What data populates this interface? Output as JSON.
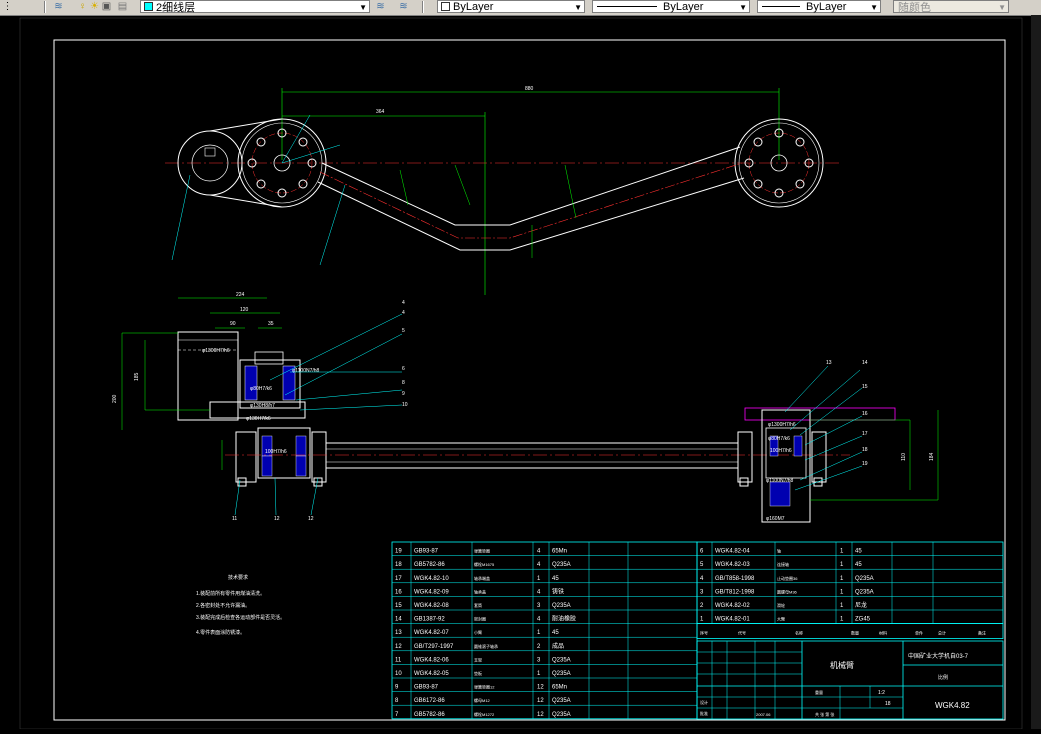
{
  "toolbar": {
    "layer_name": "2细线层",
    "color_value": "ByLayer",
    "linetype_value": "ByLayer",
    "lineweight_value": "ByLayer",
    "plotstyle_value": "随颜色"
  },
  "drawing": {
    "dims": {
      "d880": "880",
      "d364": "364",
      "d224": "224",
      "d120": "120",
      "d90": "90",
      "d35": "35",
      "d185": "185",
      "d200": "200",
      "d110": "110",
      "d184": "184"
    },
    "fits": {
      "f1": "φ1300H7/h6",
      "f2": "φ1100N7/h8",
      "f3": "φ130H8/h7",
      "f4": "φ80H7/k6",
      "f5": "100H7/h6",
      "f6": "φ130H7/k6",
      "f7": "φ160M7"
    },
    "balloons": [
      "1",
      "2",
      "3",
      "4",
      "5",
      "6",
      "7",
      "8",
      "9",
      "10",
      "11",
      "12",
      "13",
      "14",
      "15",
      "16",
      "17",
      "18",
      "19"
    ],
    "notes_title": "技术要求",
    "notes": [
      "1.装配前所有零件用煤油清洗。",
      "2.各密封处不允许漏油。",
      "3.装配完成后检查各运动部件是否灵活。",
      "4.零件表面涂防锈漆。"
    ]
  },
  "bom_left": [
    {
      "no": "19",
      "code": "GB93-87",
      "name": "弹簧垫圈",
      "qty": "4",
      "mat": "65Mn"
    },
    {
      "no": "18",
      "code": "GB5782-86",
      "name": "螺栓M1675",
      "qty": "4",
      "mat": "Q235A"
    },
    {
      "no": "17",
      "code": "WGK4.82-10",
      "name": "轴承端盖",
      "qty": "1",
      "mat": "45"
    },
    {
      "no": "16",
      "code": "WGK4.82-09",
      "name": "轴承盖",
      "qty": "4",
      "mat": "铸铁"
    },
    {
      "no": "15",
      "code": "WGK4.82-08",
      "name": "套筒",
      "qty": "3",
      "mat": "Q235A"
    },
    {
      "no": "14",
      "code": "GB1387-92",
      "name": "密封圈",
      "qty": "4",
      "mat": "耐油橡胶"
    },
    {
      "no": "13",
      "code": "WGK4.82-07",
      "name": "小臂",
      "qty": "1",
      "mat": "45"
    },
    {
      "no": "12",
      "code": "GB/T297-1997",
      "name": "圆锥滚子轴承",
      "qty": "2",
      "mat": "成品"
    },
    {
      "no": "11",
      "code": "WGK4.82-06",
      "name": "支架",
      "qty": "3",
      "mat": "Q235A"
    },
    {
      "no": "10",
      "code": "WGK4.82-05",
      "name": "垫板",
      "qty": "1",
      "mat": "Q235A"
    },
    {
      "no": "9",
      "code": "GB93-87",
      "name": "弹簧垫圈12",
      "qty": "12",
      "mat": "65Mn"
    },
    {
      "no": "8",
      "code": "GB6172-86",
      "name": "螺母M12",
      "qty": "12",
      "mat": "Q235A"
    },
    {
      "no": "7",
      "code": "GB5782-86",
      "name": "螺栓M1272",
      "qty": "12",
      "mat": "Q235A"
    }
  ],
  "bom_right": [
    {
      "no": "6",
      "code": "WGK4.82-04",
      "name": "轴",
      "qty": "1",
      "mat": "45"
    },
    {
      "no": "5",
      "code": "WGK4.82-03",
      "name": "连接轴",
      "qty": "1",
      "mat": "45"
    },
    {
      "no": "4",
      "code": "GB/T858-1998",
      "name": "止动垫圈36",
      "qty": "1",
      "mat": "Q235A"
    },
    {
      "no": "3",
      "code": "GB/T812-1998",
      "name": "圆螺母M36",
      "qty": "1",
      "mat": "Q235A"
    },
    {
      "no": "2",
      "code": "WGK4.82-02",
      "name": "滑轮",
      "qty": "1",
      "mat": "尼龙"
    },
    {
      "no": "1",
      "code": "WGK4.82-01",
      "name": "大臂",
      "qty": "1",
      "mat": "ZG45"
    }
  ],
  "bom_header": {
    "no": "序号",
    "code": "代号",
    "name": "名称",
    "qty": "数量",
    "mat": "材料",
    "weight": "重量",
    "remark": "备注",
    "single": "单件",
    "total": "总计"
  },
  "title_block": {
    "part_name": "机械臂",
    "school": "中国矿业大学机自03-7",
    "drawing_no": "WGK4.82",
    "designer_lbl": "设计",
    "checker_lbl": "审核",
    "approver_lbl": "批准",
    "date": "2007.06",
    "scale_lbl": "比例",
    "sheets": "共 张  第 张",
    "weight_lbl": "重量",
    "scale": "1:2",
    "sheet_count": "18"
  }
}
